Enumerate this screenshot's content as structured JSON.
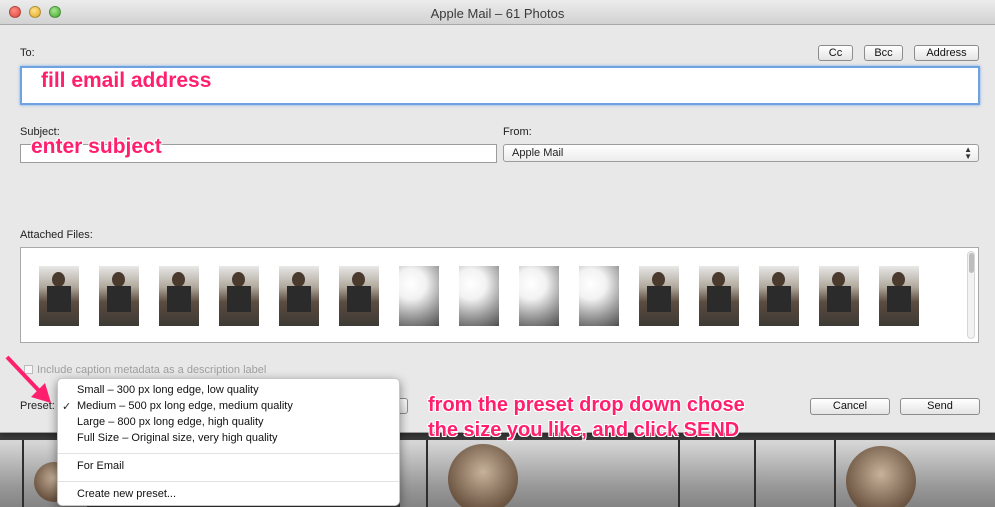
{
  "window": {
    "title": "Apple Mail – 61 Photos"
  },
  "to": {
    "label": "To:",
    "annotation": "fill email address"
  },
  "header_buttons": {
    "cc": "Cc",
    "bcc": "Bcc",
    "address": "Address"
  },
  "subject": {
    "label": "Subject:",
    "annotation": "enter subject"
  },
  "from": {
    "label": "From:",
    "value": "Apple Mail"
  },
  "attachments": {
    "label": "Attached Files:",
    "count_visible": 15
  },
  "caption_option": {
    "label": "Include caption metadata as a description label",
    "checked": false
  },
  "preset": {
    "label": "Preset:",
    "items": [
      "Small – 300 px long edge, low quality",
      "Medium – 500 px long edge, medium quality",
      "Large – 800 px long edge, high quality",
      "Full Size – Original size, very high quality"
    ],
    "selected_index": 1,
    "for_email": "For Email",
    "create_new": "Create new preset..."
  },
  "actions": {
    "cancel": "Cancel",
    "send": "Send"
  },
  "instruction": {
    "line1": "from the preset drop down chose",
    "line2": "the size you like, and click SEND"
  },
  "colors": {
    "annotation": "#ff1f6d",
    "focus_ring": "#6ea2e0"
  },
  "icons": {
    "close": "red-close-dot",
    "minimize": "yellow-minimize-dot",
    "zoom": "green-zoom-dot",
    "checkmark": "checkmark-icon",
    "popup_arrows": "updown-arrows-icon"
  }
}
